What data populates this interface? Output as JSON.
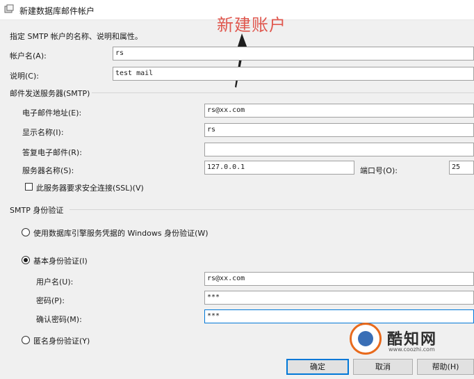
{
  "window": {
    "title": "新建数据库邮件帐户",
    "annotation": "新建账户"
  },
  "intro": "指定 SMTP 帐户的名称、说明和属性。",
  "account": {
    "name_label": "帐户名(A):",
    "name_value": "rs",
    "desc_label": "说明(C):",
    "desc_value": "test mail"
  },
  "smtp": {
    "group_label": "邮件发送服务器(SMTP)",
    "email_label": "电子邮件地址(E):",
    "email_value": "rs@xx.com",
    "display_label": "显示名称(I):",
    "display_value": "rs",
    "reply_label": "答复电子邮件(R):",
    "reply_value": "",
    "server_label": "服务器名称(S):",
    "server_value": "127.0.0.1",
    "port_label": "端口号(O):",
    "port_value": "25",
    "ssl_label": "此服务器要求安全连接(SSL)(V)",
    "ssl_checked": false
  },
  "auth": {
    "group_label": "SMTP 身份验证",
    "windows_label": "使用数据库引擎服务凭据的 Windows 身份验证(W)",
    "basic_label": "基本身份验证(I)",
    "username_label": "用户名(U):",
    "username_value": "rs@xx.com",
    "password_label": "密码(P):",
    "password_value": "***",
    "confirm_label": "确认密码(M):",
    "confirm_value": "***",
    "anonymous_label": "匿名身份验证(Y)",
    "selected": "basic"
  },
  "buttons": {
    "ok": "确定",
    "cancel": "取消",
    "help": "帮助(H)"
  },
  "watermark": {
    "name": "酷知网",
    "url": "www.coozhi.com"
  },
  "colors": {
    "annotation": "#e0584f",
    "focus": "#0078d7"
  }
}
